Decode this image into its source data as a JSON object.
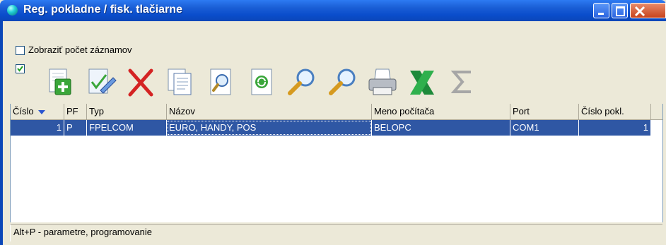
{
  "window": {
    "title": "Reg. pokladne / fisk. tlačiarne"
  },
  "options": {
    "show_count_label": "Zobraziť počet záznamov",
    "show_count_checked": false,
    "second_checked": true
  },
  "toolbar": {
    "icons": [
      "add-icon",
      "edit-icon",
      "delete-icon",
      "copy-icon",
      "view-icon",
      "refresh-icon",
      "search-icon",
      "search-next-icon",
      "print-icon",
      "excel-icon",
      "sum-icon"
    ]
  },
  "grid": {
    "columns": [
      "Číslo",
      "PF",
      "Typ",
      "Názov",
      "Meno počítača",
      "Port",
      "Číslo pokl."
    ],
    "rows": [
      [
        "1",
        "P",
        "FPELCOM",
        "EURO, HANDY, POS",
        "BELOPC",
        "COM1",
        "1"
      ]
    ]
  },
  "status": {
    "text": "Alt+P - parametre, programovanie"
  },
  "colors": {
    "selection": "#2f57a4",
    "titlebar": "#0a4dcc"
  }
}
